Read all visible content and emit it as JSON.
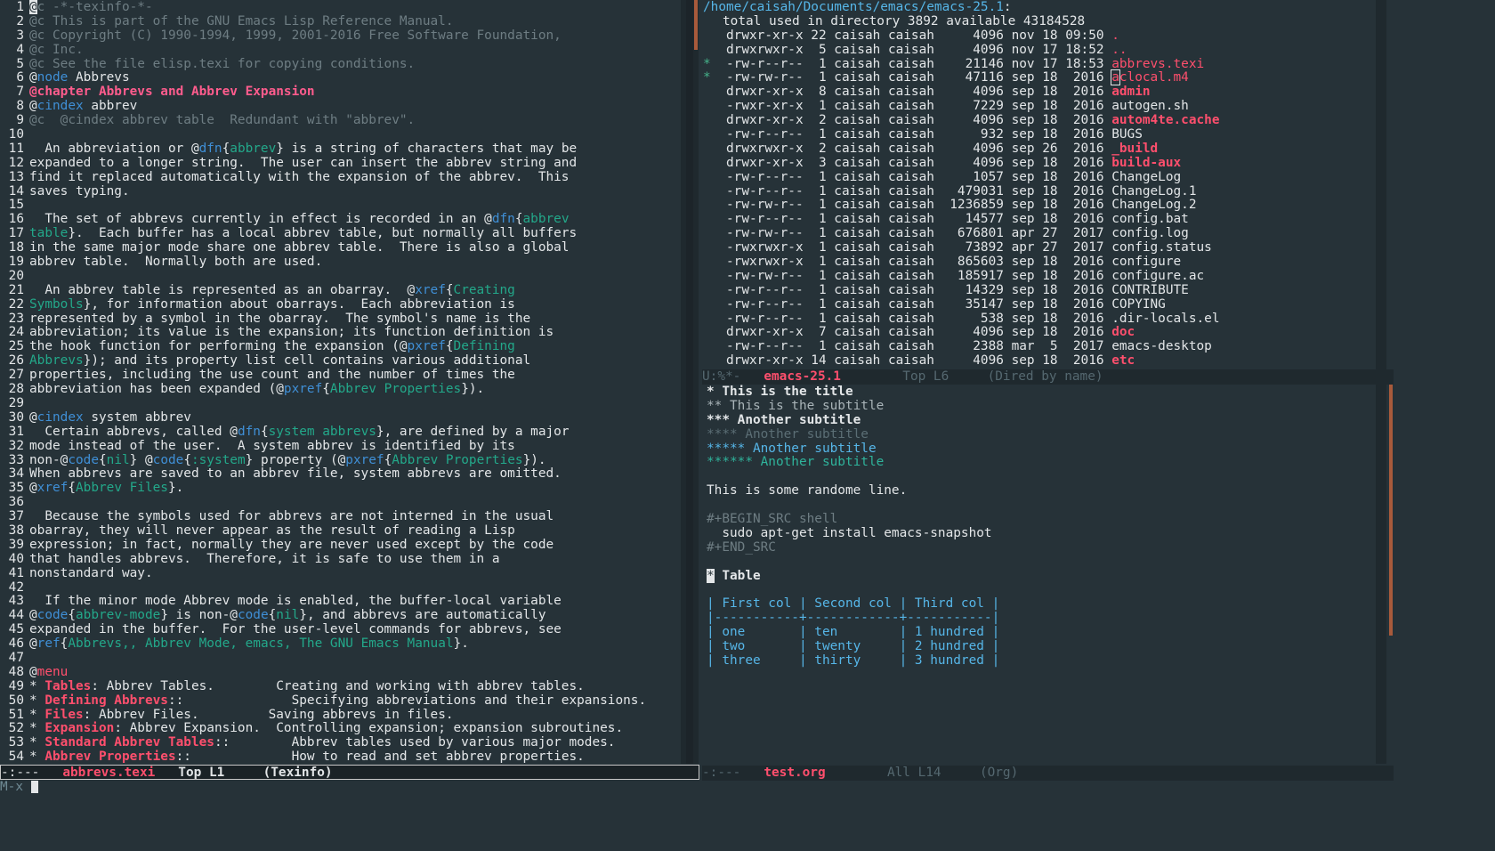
{
  "left": {
    "line_numbers": [
      "1",
      "2",
      "3",
      "4",
      "5",
      "6",
      "7",
      "8",
      "9",
      "10",
      "11",
      "12",
      "13",
      "14",
      "15",
      "16",
      "17",
      "18",
      "19",
      "20",
      "21",
      "22",
      "23",
      "24",
      "25",
      "26",
      "27",
      "28",
      "29",
      "30",
      "31",
      "32",
      "33",
      "34",
      "35",
      "36",
      "37",
      "38",
      "39",
      "40",
      "41",
      "42",
      "43",
      "44",
      "45",
      "46",
      "47",
      "48",
      "49",
      "50",
      "51",
      "52",
      "53",
      "54"
    ],
    "lines": [
      [
        [
          "cursor",
          "@"
        ],
        [
          "cmt",
          "c -*-texinfo-*-"
        ]
      ],
      [
        [
          "cmt",
          "@c This is part of the GNU Emacs Lisp Reference Manual."
        ]
      ],
      [
        [
          "cmt",
          "@c Copyright (C) 1990-1994, 1999, 2001-2016 Free Software Foundation,"
        ]
      ],
      [
        [
          "cmt",
          "@c Inc."
        ]
      ],
      [
        [
          "cmt",
          "@c See the file elisp.texi for copying conditions."
        ]
      ],
      [
        [
          "",
          "@"
        ],
        [
          "kw",
          "node"
        ],
        [
          "",
          " Abbrevs"
        ]
      ],
      [
        [
          "chap",
          "@chapter Abbrevs and Abbrev Expansion"
        ]
      ],
      [
        [
          "",
          "@"
        ],
        [
          "kw",
          "cindex"
        ],
        [
          "",
          " abbrev"
        ]
      ],
      [
        [
          "cmt",
          "@c  @cindex abbrev table  Redundant with \"abbrev\"."
        ]
      ],
      [
        [
          "",
          ""
        ]
      ],
      [
        [
          "",
          "  An abbreviation or @"
        ],
        [
          "kw",
          "dfn"
        ],
        [
          "",
          "{"
        ],
        [
          "fn",
          "abbrev"
        ],
        [
          "",
          "} is a string of characters that may be"
        ]
      ],
      [
        [
          "",
          "expanded to a longer string.  The user can insert the abbrev string and"
        ]
      ],
      [
        [
          "",
          "find it replaced automatically with the expansion of the abbrev.  This"
        ]
      ],
      [
        [
          "",
          "saves typing."
        ]
      ],
      [
        [
          "",
          ""
        ]
      ],
      [
        [
          "",
          "  The set of abbrevs currently in effect is recorded in an @"
        ],
        [
          "kw",
          "dfn"
        ],
        [
          "",
          "{"
        ],
        [
          "fn",
          "abbrev"
        ]
      ],
      [
        [
          "fn",
          "table"
        ],
        [
          "",
          "}.  Each buffer has a local abbrev table, but normally all buffers"
        ]
      ],
      [
        [
          "",
          "in the same major mode share one abbrev table.  There is also a global"
        ]
      ],
      [
        [
          "",
          "abbrev table.  Normally both are used."
        ]
      ],
      [
        [
          "",
          ""
        ]
      ],
      [
        [
          "",
          "  An abbrev table is represented as an obarray.  @"
        ],
        [
          "kw",
          "xref"
        ],
        [
          "",
          "{"
        ],
        [
          "fn",
          "Creating"
        ]
      ],
      [
        [
          "fn",
          "Symbols"
        ],
        [
          "",
          "}, for information about obarrays.  Each abbreviation is"
        ]
      ],
      [
        [
          "",
          "represented by a symbol in the obarray.  The symbol's name is the"
        ]
      ],
      [
        [
          "",
          "abbreviation; its value is the expansion; its function definition is"
        ]
      ],
      [
        [
          "",
          "the hook function for performing the expansion (@"
        ],
        [
          "kw",
          "pxref"
        ],
        [
          "",
          "{"
        ],
        [
          "fn",
          "Defining"
        ]
      ],
      [
        [
          "fn",
          "Abbrevs"
        ],
        [
          "",
          "}); and its property list cell contains various additional"
        ]
      ],
      [
        [
          "",
          "properties, including the use count and the number of times the"
        ]
      ],
      [
        [
          "",
          "abbreviation has been expanded (@"
        ],
        [
          "kw",
          "pxref"
        ],
        [
          "",
          "{"
        ],
        [
          "fn",
          "Abbrev Properties"
        ],
        [
          "",
          "})."
        ]
      ],
      [
        [
          "",
          ""
        ]
      ],
      [
        [
          "",
          "@"
        ],
        [
          "kw",
          "cindex"
        ],
        [
          "",
          " system abbrev"
        ]
      ],
      [
        [
          "",
          "  Certain abbrevs, called @"
        ],
        [
          "kw",
          "dfn"
        ],
        [
          "",
          "{"
        ],
        [
          "fn",
          "system abbrevs"
        ],
        [
          "",
          "}, are defined by a major"
        ]
      ],
      [
        [
          "",
          "mode instead of the user.  A system abbrev is identified by its"
        ]
      ],
      [
        [
          "",
          "non-@"
        ],
        [
          "kw",
          "code"
        ],
        [
          "",
          "{"
        ],
        [
          "fn",
          "nil"
        ],
        [
          "",
          "} @"
        ],
        [
          "kw",
          "code"
        ],
        [
          "",
          "{"
        ],
        [
          "fn",
          ":system"
        ],
        [
          "",
          "} property (@"
        ],
        [
          "kw",
          "pxref"
        ],
        [
          "",
          "{"
        ],
        [
          "fn",
          "Abbrev Properties"
        ],
        [
          "",
          "})."
        ]
      ],
      [
        [
          "",
          "When abbrevs are saved to an abbrev file, system abbrevs are omitted."
        ]
      ],
      [
        [
          "",
          "@"
        ],
        [
          "kw",
          "xref"
        ],
        [
          "",
          "{"
        ],
        [
          "fn",
          "Abbrev Files"
        ],
        [
          "",
          "}."
        ]
      ],
      [
        [
          "",
          ""
        ]
      ],
      [
        [
          "",
          "  Because the symbols used for abbrevs are not interned in the usual"
        ]
      ],
      [
        [
          "",
          "obarray, they will never appear as the result of reading a Lisp"
        ]
      ],
      [
        [
          "",
          "expression; in fact, normally they are never used except by the code"
        ]
      ],
      [
        [
          "",
          "that handles abbrevs.  Therefore, it is safe to use them in a"
        ]
      ],
      [
        [
          "",
          "nonstandard way."
        ]
      ],
      [
        [
          "",
          ""
        ]
      ],
      [
        [
          "",
          "  If the minor mode Abbrev mode is enabled, the buffer-local variable"
        ]
      ],
      [
        [
          "",
          "@"
        ],
        [
          "kw",
          "code"
        ],
        [
          "",
          "{"
        ],
        [
          "fn",
          "abbrev-mode"
        ],
        [
          "",
          "} is non-@"
        ],
        [
          "kw",
          "code"
        ],
        [
          "",
          "{"
        ],
        [
          "fn",
          "nil"
        ],
        [
          "",
          "}, and abbrevs are automatically"
        ]
      ],
      [
        [
          "",
          "expanded in the buffer.  For the user-level commands for abbrevs, see"
        ]
      ],
      [
        [
          "",
          "@"
        ],
        [
          "kw",
          "ref"
        ],
        [
          "",
          "{"
        ],
        [
          "fn",
          "Abbrevs,, Abbrev Mode, emacs, The GNU Emacs Manual"
        ],
        [
          "",
          "}."
        ]
      ],
      [
        [
          "",
          ""
        ]
      ],
      [
        [
          "",
          "@"
        ],
        [
          "red",
          "menu"
        ]
      ],
      [
        [
          "",
          "* "
        ],
        [
          "redb",
          "Tables"
        ],
        [
          "",
          ": Abbrev Tables.        Creating and working with abbrev tables."
        ]
      ],
      [
        [
          "",
          "* "
        ],
        [
          "redb",
          "Defining Abbrevs"
        ],
        [
          "",
          "::              Specifying abbreviations and their expansions."
        ]
      ],
      [
        [
          "",
          "* "
        ],
        [
          "redb",
          "Files"
        ],
        [
          "",
          ": Abbrev Files.         Saving abbrevs in files."
        ]
      ],
      [
        [
          "",
          "* "
        ],
        [
          "redb",
          "Expansion"
        ],
        [
          "",
          ": Abbrev Expansion.  Controlling expansion; expansion subroutines."
        ]
      ],
      [
        [
          "",
          "* "
        ],
        [
          "redb",
          "Standard Abbrev Tables"
        ],
        [
          "",
          "::        Abbrev tables used by various major modes."
        ]
      ],
      [
        [
          "",
          "* "
        ],
        [
          "redb",
          "Abbrev Properties"
        ],
        [
          "",
          "::             How to read and set abbrev properties."
        ]
      ]
    ],
    "modeline": {
      "status": "-:---",
      "buffer": "abbrevs.texi",
      "position": "Top L1",
      "mode": "(Texinfo)"
    }
  },
  "dired": {
    "path": "/home/caisah/Documents/emacs/emacs-25.1",
    "summary": "total used in directory 3892 available 43184528",
    "entries": [
      {
        "mark": " ",
        "perms": "drwxr-xr-x",
        "links": "22",
        "owner": "caisah",
        "group": "caisah",
        "size": "4096",
        "date": "nov 18 09:50",
        "name": ".",
        "style": "red"
      },
      {
        "mark": " ",
        "perms": "drwxrwxr-x",
        "links": " 5",
        "owner": "caisah",
        "group": "caisah",
        "size": "4096",
        "date": "nov 17 18:52",
        "name": "..",
        "style": "red"
      },
      {
        "mark": "*",
        "perms": "-rw-r--r--",
        "links": " 1",
        "owner": "caisah",
        "group": "caisah",
        "size": "21146",
        "date": "nov 17 18:53",
        "name": "abbrevs.texi",
        "style": "red"
      },
      {
        "mark": "*",
        "perms": "-rw-rw-r--",
        "links": " 1",
        "owner": "caisah",
        "group": "caisah",
        "size": "47116",
        "date": "sep 18  2016",
        "name": "aclocal.m4",
        "style": "red"
      },
      {
        "mark": " ",
        "perms": "drwxr-xr-x",
        "links": " 8",
        "owner": "caisah",
        "group": "caisah",
        "size": "4096",
        "date": "sep 18  2016",
        "name": "admin",
        "style": "redb"
      },
      {
        "mark": " ",
        "perms": "-rwxr-xr-x",
        "links": " 1",
        "owner": "caisah",
        "group": "caisah",
        "size": "7229",
        "date": "sep 18  2016",
        "name": "autogen.sh",
        "style": ""
      },
      {
        "mark": " ",
        "perms": "drwxr-xr-x",
        "links": " 2",
        "owner": "caisah",
        "group": "caisah",
        "size": "4096",
        "date": "sep 18  2016",
        "name": "autom4te.cache",
        "style": "redb"
      },
      {
        "mark": " ",
        "perms": "-rw-r--r--",
        "links": " 1",
        "owner": "caisah",
        "group": "caisah",
        "size": "932",
        "date": "sep 18  2016",
        "name": "BUGS",
        "style": ""
      },
      {
        "mark": " ",
        "perms": "drwxrwxr-x",
        "links": " 2",
        "owner": "caisah",
        "group": "caisah",
        "size": "4096",
        "date": "sep 26  2016",
        "name": "_build",
        "style": "redb"
      },
      {
        "mark": " ",
        "perms": "drwxr-xr-x",
        "links": " 3",
        "owner": "caisah",
        "group": "caisah",
        "size": "4096",
        "date": "sep 18  2016",
        "name": "build-aux",
        "style": "redb"
      },
      {
        "mark": " ",
        "perms": "-rw-r--r--",
        "links": " 1",
        "owner": "caisah",
        "group": "caisah",
        "size": "1057",
        "date": "sep 18  2016",
        "name": "ChangeLog",
        "style": ""
      },
      {
        "mark": " ",
        "perms": "-rw-r--r--",
        "links": " 1",
        "owner": "caisah",
        "group": "caisah",
        "size": "479031",
        "date": "sep 18  2016",
        "name": "ChangeLog.1",
        "style": ""
      },
      {
        "mark": " ",
        "perms": "-rw-rw-r--",
        "links": " 1",
        "owner": "caisah",
        "group": "caisah",
        "size": "1236859",
        "date": "sep 18  2016",
        "name": "ChangeLog.2",
        "style": ""
      },
      {
        "mark": " ",
        "perms": "-rw-r--r--",
        "links": " 1",
        "owner": "caisah",
        "group": "caisah",
        "size": "14577",
        "date": "sep 18  2016",
        "name": "config.bat",
        "style": ""
      },
      {
        "mark": " ",
        "perms": "-rw-rw-r--",
        "links": " 1",
        "owner": "caisah",
        "group": "caisah",
        "size": "676801",
        "date": "apr 27  2017",
        "name": "config.log",
        "style": ""
      },
      {
        "mark": " ",
        "perms": "-rwxrwxr-x",
        "links": " 1",
        "owner": "caisah",
        "group": "caisah",
        "size": "73892",
        "date": "apr 27  2017",
        "name": "config.status",
        "style": ""
      },
      {
        "mark": " ",
        "perms": "-rwxrwxr-x",
        "links": " 1",
        "owner": "caisah",
        "group": "caisah",
        "size": "865603",
        "date": "sep 18  2016",
        "name": "configure",
        "style": ""
      },
      {
        "mark": " ",
        "perms": "-rw-rw-r--",
        "links": " 1",
        "owner": "caisah",
        "group": "caisah",
        "size": "185917",
        "date": "sep 18  2016",
        "name": "configure.ac",
        "style": ""
      },
      {
        "mark": " ",
        "perms": "-rw-r--r--",
        "links": " 1",
        "owner": "caisah",
        "group": "caisah",
        "size": "14329",
        "date": "sep 18  2016",
        "name": "CONTRIBUTE",
        "style": ""
      },
      {
        "mark": " ",
        "perms": "-rw-r--r--",
        "links": " 1",
        "owner": "caisah",
        "group": "caisah",
        "size": "35147",
        "date": "sep 18  2016",
        "name": "COPYING",
        "style": ""
      },
      {
        "mark": " ",
        "perms": "-rw-r--r--",
        "links": " 1",
        "owner": "caisah",
        "group": "caisah",
        "size": "538",
        "date": "sep 18  2016",
        "name": ".dir-locals.el",
        "style": ""
      },
      {
        "mark": " ",
        "perms": "drwxr-xr-x",
        "links": " 7",
        "owner": "caisah",
        "group": "caisah",
        "size": "4096",
        "date": "sep 18  2016",
        "name": "doc",
        "style": "redb"
      },
      {
        "mark": " ",
        "perms": "-rw-r--r--",
        "links": " 1",
        "owner": "caisah",
        "group": "caisah",
        "size": "2388",
        "date": "mar  5  2017",
        "name": "emacs-desktop",
        "style": ""
      },
      {
        "mark": " ",
        "perms": "drwxr-xr-x",
        "links": "14",
        "owner": "caisah",
        "group": "caisah",
        "size": "4096",
        "date": "sep 18  2016",
        "name": "etc",
        "style": "redb"
      }
    ],
    "modeline": {
      "status": "U:%*-",
      "buffer": "emacs-25.1",
      "position": "Top L6",
      "mode": "(Dired by name)"
    }
  },
  "org": {
    "lines": [
      [
        [
          "w1",
          "* This is the title"
        ]
      ],
      [
        [
          "h2",
          "** This is the subtitle"
        ]
      ],
      [
        [
          "h3",
          "*** Another subtitle"
        ]
      ],
      [
        [
          "h4",
          "**** Another subtitle"
        ]
      ],
      [
        [
          "h5",
          "***** Another subtitle"
        ]
      ],
      [
        [
          "h6",
          "****** Another subtitle"
        ]
      ],
      [
        [
          "",
          ""
        ]
      ],
      [
        [
          "",
          "This is some randome line."
        ]
      ],
      [
        [
          "",
          ""
        ]
      ],
      [
        [
          "dim",
          "#+BEGIN_SRC shell"
        ]
      ],
      [
        [
          "",
          "  sudo apt-get install emacs-snapshot"
        ]
      ],
      [
        [
          "dim",
          "#+END_SRC"
        ]
      ],
      [
        [
          "",
          ""
        ]
      ],
      [
        [
          "cursor",
          "*"
        ],
        [
          "w1",
          " Table"
        ]
      ],
      [
        [
          "",
          ""
        ]
      ],
      [
        [
          "tbl",
          "| First col | Second col | Third col |"
        ]
      ],
      [
        [
          "tbl",
          "|-----------+------------+-----------|"
        ]
      ],
      [
        [
          "tbl",
          "| one       | ten        | 1 hundred |"
        ]
      ],
      [
        [
          "tbl",
          "| two       | twenty     | 2 hundred |"
        ]
      ],
      [
        [
          "tbl",
          "| three     | thirty     | 3 hundred |"
        ]
      ]
    ],
    "modeline": {
      "status": "-:---",
      "buffer": "test.org",
      "position": "All L14",
      "mode": "(Org)"
    }
  },
  "minibuffer": {
    "prompt": "M-x "
  }
}
